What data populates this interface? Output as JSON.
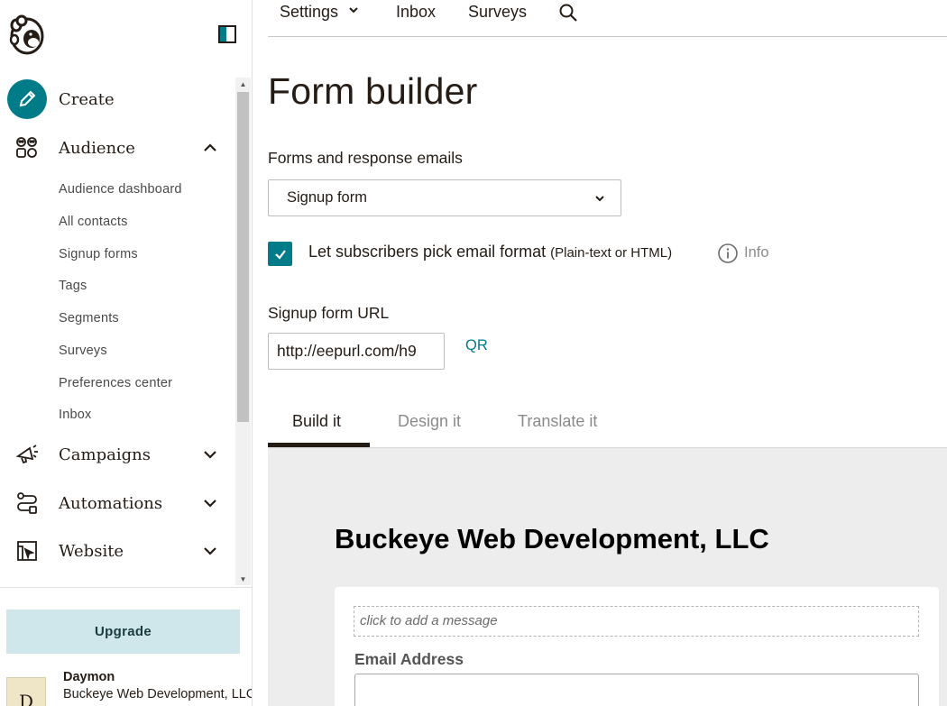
{
  "sidebar": {
    "nav": [
      {
        "label": "Create"
      },
      {
        "label": "Audience"
      },
      {
        "label": "Campaigns"
      },
      {
        "label": "Automations"
      },
      {
        "label": "Website"
      }
    ],
    "audience_items": [
      {
        "label": "Audience dashboard"
      },
      {
        "label": "All contacts"
      },
      {
        "label": "Signup forms"
      },
      {
        "label": "Tags"
      },
      {
        "label": "Segments"
      },
      {
        "label": "Surveys"
      },
      {
        "label": "Preferences center"
      },
      {
        "label": "Inbox"
      }
    ],
    "upgrade_label": "Upgrade",
    "user": {
      "initial": "D",
      "name": "Daymon",
      "org": "Buckeye Web Development, LLC"
    }
  },
  "topnav": {
    "items": [
      {
        "label": "Settings"
      },
      {
        "label": "Inbox"
      },
      {
        "label": "Surveys"
      }
    ]
  },
  "main": {
    "title": "Form builder",
    "forms_label": "Forms and response emails",
    "form_select_value": "Signup form",
    "format_checkbox": {
      "checked": true,
      "label": "Let subscribers pick email format",
      "label_note": "(Plain-text or HTML)",
      "info_label": "Info"
    },
    "url_label": "Signup form URL",
    "url_value": "http://eepurl.com/h9",
    "qr_label": "QR",
    "tabs": [
      {
        "label": "Build it",
        "active": true
      },
      {
        "label": "Design it",
        "active": false
      },
      {
        "label": "Translate it",
        "active": false
      }
    ]
  },
  "preview": {
    "org_name": "Buckeye Web Development, LLC",
    "message_placeholder": "click to add a message",
    "email_label": "Email Address"
  },
  "colors": {
    "accent": "#007c89",
    "upgrade_bg": "#cfe6ea",
    "preview_bg": "#ededed"
  }
}
